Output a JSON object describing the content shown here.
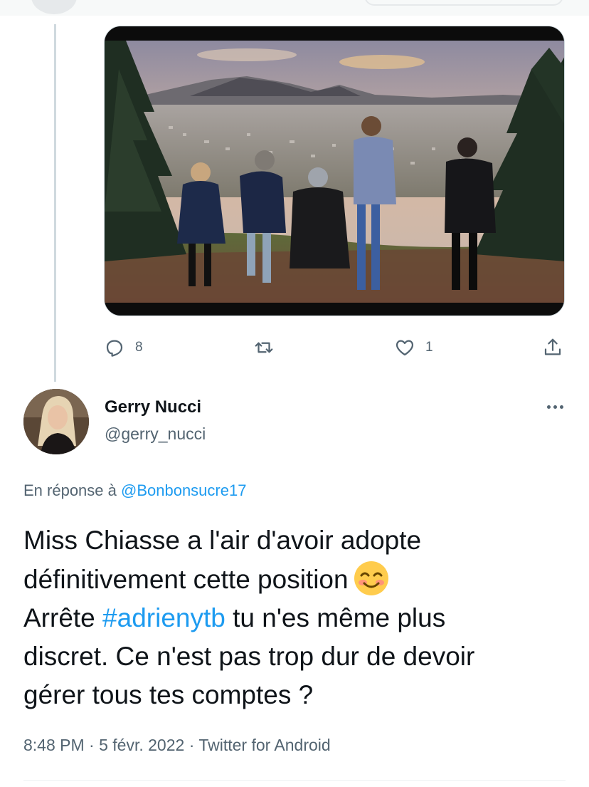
{
  "previous_tweet": {
    "actions": {
      "reply_count": "8",
      "retweet_count": "",
      "like_count": "1"
    }
  },
  "tweet": {
    "author": {
      "display_name": "Gerry Nucci",
      "handle": "@gerry_nucci"
    },
    "reply_to": {
      "prefix": "En réponse à",
      "mention": "@Bonbonsucre17"
    },
    "text": {
      "line1": "Miss Chiasse a l'air d'avoir adopte",
      "line2": "définitivement cette position",
      "line3_start": "Arrête ",
      "hashtag": "#adrienytb",
      "line3_end": " tu n'es même plus",
      "line4": "discret. Ce n'est pas trop dur de devoir",
      "line5": "gérer tous tes comptes ?"
    },
    "meta": {
      "time": "8:48 PM",
      "separator1": " · ",
      "date": "5 févr. 2022",
      "separator2": " · ",
      "source": "Twitter for Android"
    }
  },
  "icons": [
    "reply-icon",
    "retweet-icon",
    "like-icon",
    "share-icon",
    "more-icon",
    "smiling-face-emoji"
  ],
  "colors": {
    "link": "#1d9bf0",
    "secondary_text": "#536471",
    "primary_text": "#0f1419",
    "thread_line": "#cfd9de"
  }
}
